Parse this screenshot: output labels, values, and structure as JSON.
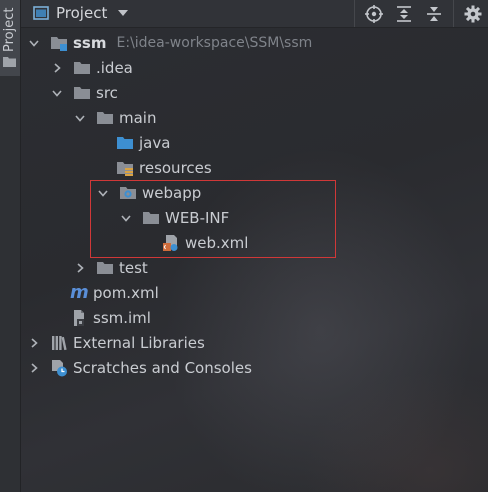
{
  "side_strip": {
    "tab_label": "Project"
  },
  "header": {
    "title": "Project",
    "actions": [
      "locate-icon",
      "expand-all-icon",
      "collapse-all-icon",
      "settings-icon"
    ]
  },
  "tree": {
    "rows": [
      {
        "label": "ssm",
        "path": "E:\\idea-workspace\\SSM\\ssm",
        "icon": "module-folder-icon",
        "expanded": true
      },
      {
        "label": ".idea",
        "icon": "folder-icon",
        "expanded": false
      },
      {
        "label": "src",
        "icon": "folder-icon",
        "expanded": true
      },
      {
        "label": "main",
        "icon": "folder-icon",
        "expanded": true
      },
      {
        "label": "java",
        "icon": "source-folder-icon"
      },
      {
        "label": "resources",
        "icon": "resources-folder-icon"
      },
      {
        "label": "webapp",
        "icon": "web-folder-icon",
        "expanded": true
      },
      {
        "label": "WEB-INF",
        "icon": "folder-icon",
        "expanded": true
      },
      {
        "label": "web.xml",
        "icon": "xml-file-icon"
      },
      {
        "label": "test",
        "icon": "folder-icon",
        "expanded": false
      },
      {
        "label": "pom.xml",
        "icon": "maven-icon"
      },
      {
        "label": "ssm.iml",
        "icon": "iml-file-icon"
      },
      {
        "label": "External Libraries",
        "icon": "libraries-icon",
        "expanded": false
      },
      {
        "label": "Scratches and Consoles",
        "icon": "scratches-icon",
        "expanded": false
      }
    ]
  },
  "colors": {
    "highlight_border": "#d03838",
    "folder": "#8a8e95",
    "source_folder": "#3d8fd1",
    "maven": "#5a8fd8"
  }
}
